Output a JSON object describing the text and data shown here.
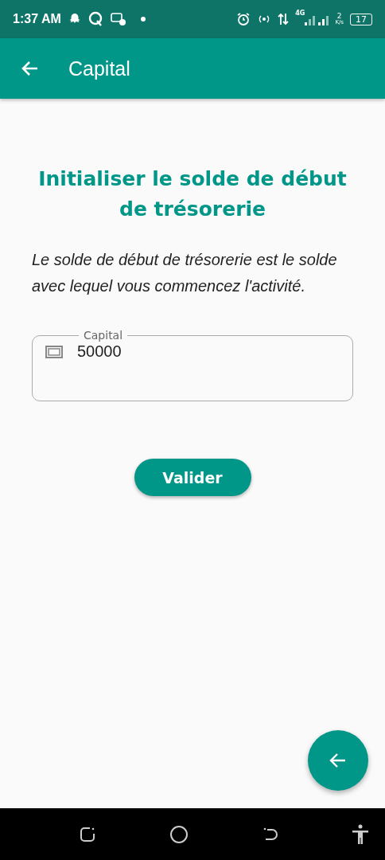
{
  "status_bar": {
    "time": "1:37 AM",
    "network": "4G",
    "speed_value": "2",
    "speed_unit": "K/s",
    "battery": "17"
  },
  "app_bar": {
    "title": "Capital"
  },
  "heading": "Initialiser le solde de début de trésorerie",
  "description": "Le solde de début de trésorerie est le solde avec lequel vous commencez l'activité.",
  "field": {
    "label": "Capital",
    "value": "50000"
  },
  "button": "Valider"
}
